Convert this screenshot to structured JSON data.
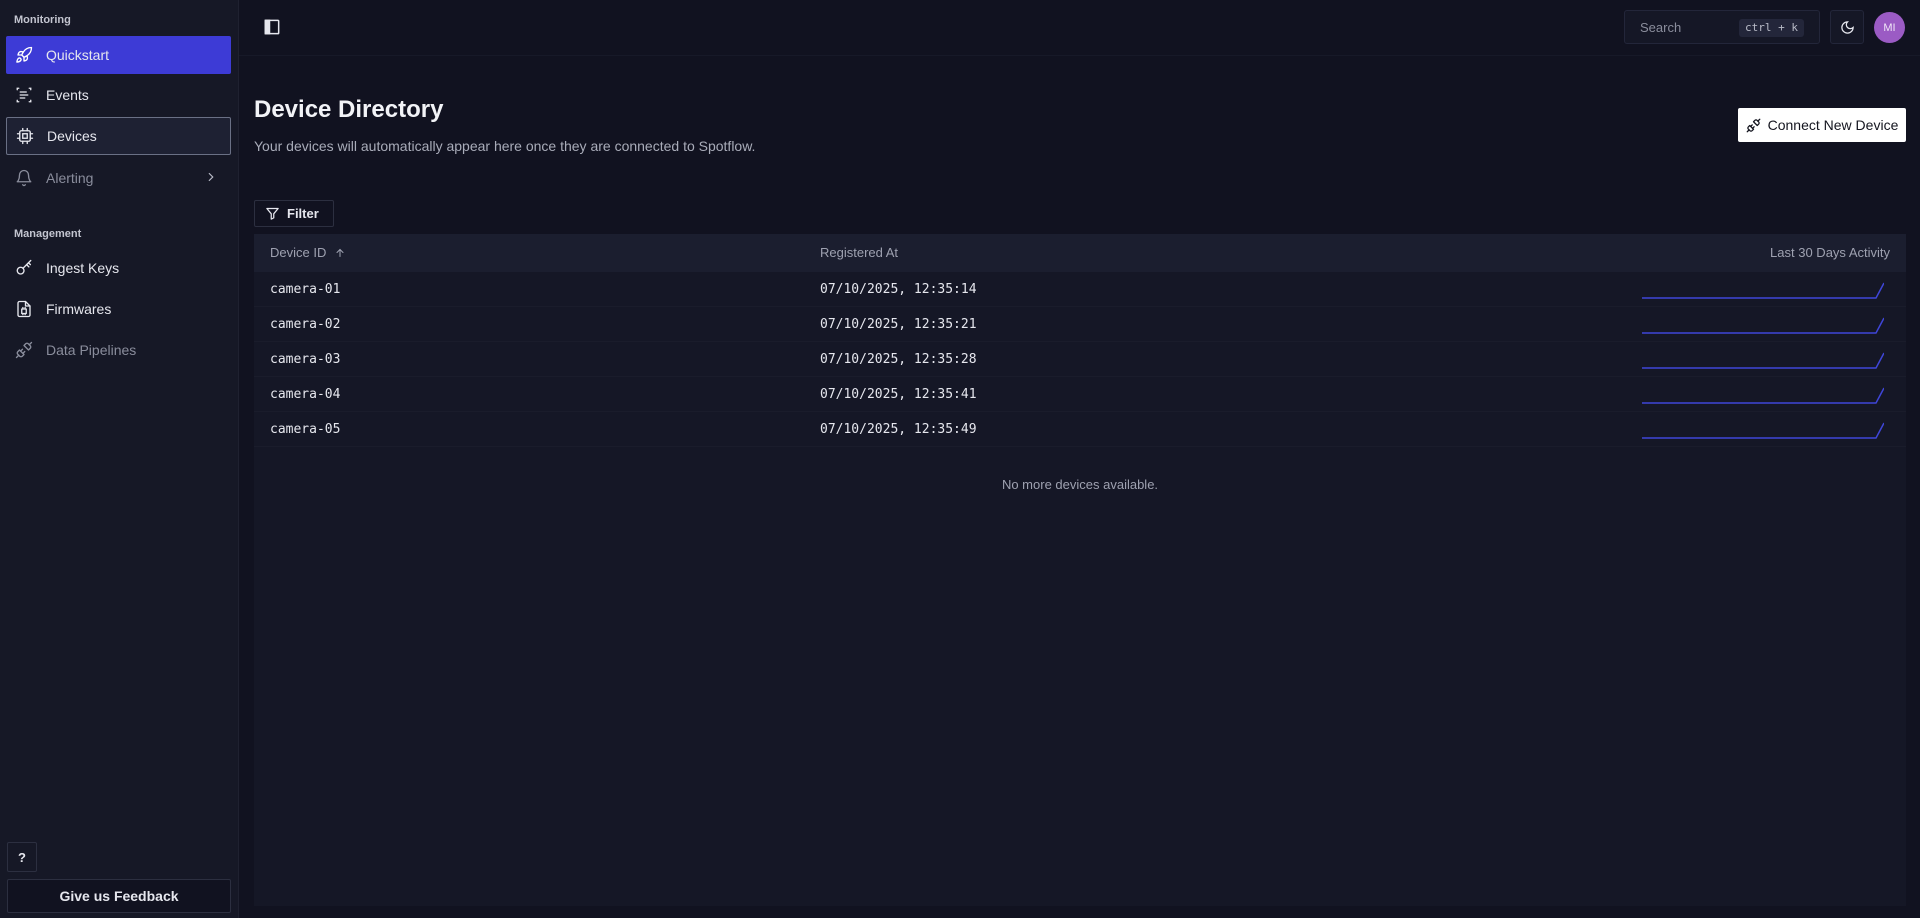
{
  "sidebar": {
    "monitoring_title": "Monitoring",
    "management_title": "Management",
    "items": [
      {
        "label": "Quickstart"
      },
      {
        "label": "Events"
      },
      {
        "label": "Devices"
      },
      {
        "label": "Alerting"
      },
      {
        "label": "Ingest Keys"
      },
      {
        "label": "Firmwares"
      },
      {
        "label": "Data Pipelines"
      }
    ],
    "help_label": "?",
    "feedback_label": "Give us Feedback"
  },
  "topbar": {
    "search_placeholder": "Search",
    "search_shortcut": "ctrl + k",
    "avatar_initials": "MI"
  },
  "page": {
    "title": "Device Directory",
    "subtitle": "Your devices will automatically appear here once they are connected to Spotflow.",
    "connect_button": "Connect New Device",
    "filter_button": "Filter"
  },
  "table": {
    "columns": [
      "Device ID",
      "Registered At",
      "Last 30 Days Activity"
    ],
    "rows": [
      {
        "device_id": "camera-01",
        "registered_at": "07/10/2025, 12:35:14"
      },
      {
        "device_id": "camera-02",
        "registered_at": "07/10/2025, 12:35:21"
      },
      {
        "device_id": "camera-03",
        "registered_at": "07/10/2025, 12:35:28"
      },
      {
        "device_id": "camera-04",
        "registered_at": "07/10/2025, 12:35:41"
      },
      {
        "device_id": "camera-05",
        "registered_at": "07/10/2025, 12:35:49"
      }
    ],
    "empty_message": "No more devices available."
  },
  "colors": {
    "accent": "#3d3bd6",
    "background": "#111220",
    "sidebar": "#161826",
    "avatar": "#9b5bc4",
    "sparkline": "#3f46d8"
  },
  "icons": {
    "quickstart": "rocket-icon",
    "events": "list-icon",
    "devices": "chip-icon",
    "alerting": "bell-icon",
    "ingest_keys": "key-icon",
    "firmwares": "file-chip-icon",
    "data_pipelines": "plug-icon"
  }
}
